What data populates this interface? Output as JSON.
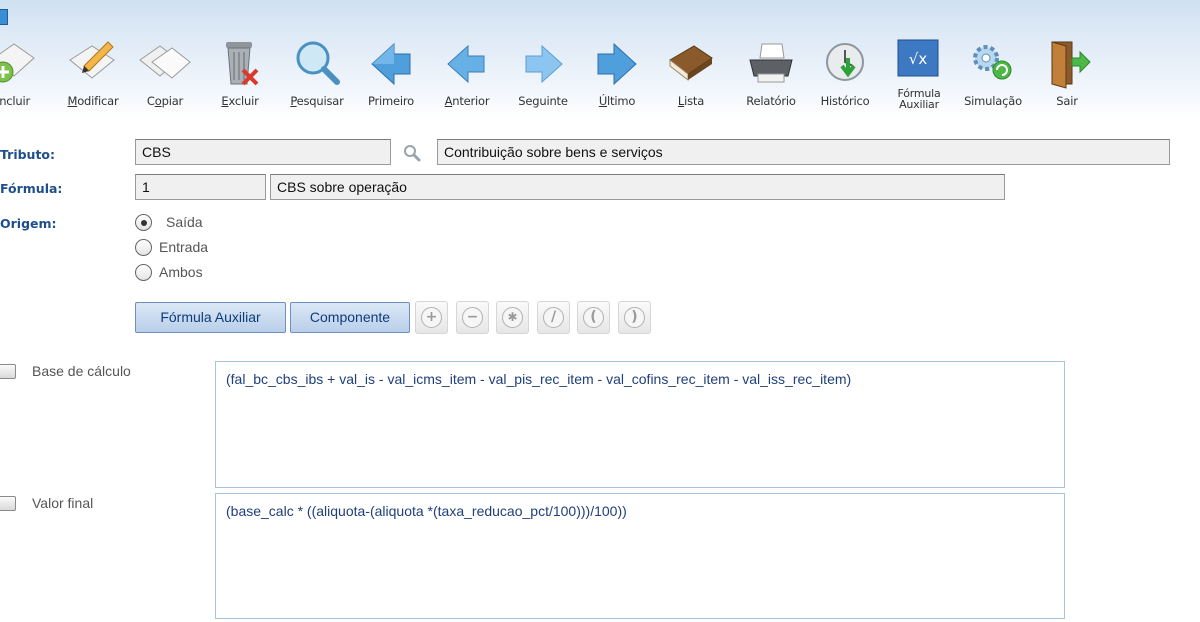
{
  "toolbar": {
    "buttons": [
      {
        "pre": "",
        "u": "I",
        "post": "ncluir"
      },
      {
        "pre": "",
        "u": "M",
        "post": "odificar"
      },
      {
        "pre": "C",
        "u": "o",
        "post": "piar"
      },
      {
        "pre": "",
        "u": "E",
        "post": "xcluir"
      },
      {
        "pre": "",
        "u": "P",
        "post": "esquisar"
      },
      {
        "pre": "Primeiro",
        "u": "",
        "post": ""
      },
      {
        "pre": "",
        "u": "A",
        "post": "nterior"
      },
      {
        "pre": "Seguinte",
        "u": "",
        "post": ""
      },
      {
        "pre": "",
        "u": "Ú",
        "post": "ltimo"
      },
      {
        "pre": "",
        "u": "L",
        "post": "ista"
      },
      {
        "pre": "Relatório",
        "u": "",
        "post": ""
      },
      {
        "pre": "Histórico",
        "u": "",
        "post": ""
      },
      {
        "pre": "Fórmula Auxiliar",
        "u": "",
        "post": ""
      },
      {
        "pre": "Simulação",
        "u": "",
        "post": ""
      },
      {
        "pre": "Sair",
        "u": "",
        "post": ""
      }
    ]
  },
  "form": {
    "tributo_label": "Tributo:",
    "tributo_code": "CBS",
    "tributo_desc": "Contribuição sobre bens e serviços",
    "formula_label": "Fórmula:",
    "formula_code": "1",
    "formula_desc": "CBS sobre operação",
    "origem_label": "Origem:",
    "origem_options": [
      "Saída",
      "Entrada",
      "Ambos"
    ],
    "origem_selected": "Saída"
  },
  "buttons": {
    "formula_auxiliar": "Fórmula Auxiliar",
    "componente": "Componente",
    "operators": [
      "+",
      "−",
      "✱",
      "/",
      "(",
      ")"
    ]
  },
  "sections": {
    "base_label": "Base de cálculo",
    "base_formula": "(fal_bc_cbs_ibs + val_is - val_icms_item - val_pis_rec_item - val_cofins_rec_item - val_iss_rec_item)",
    "valor_label": "Valor final",
    "valor_formula": "(base_calc * ((aliquota-(aliquota *(taxa_reducao_pct/100)))/100))"
  }
}
